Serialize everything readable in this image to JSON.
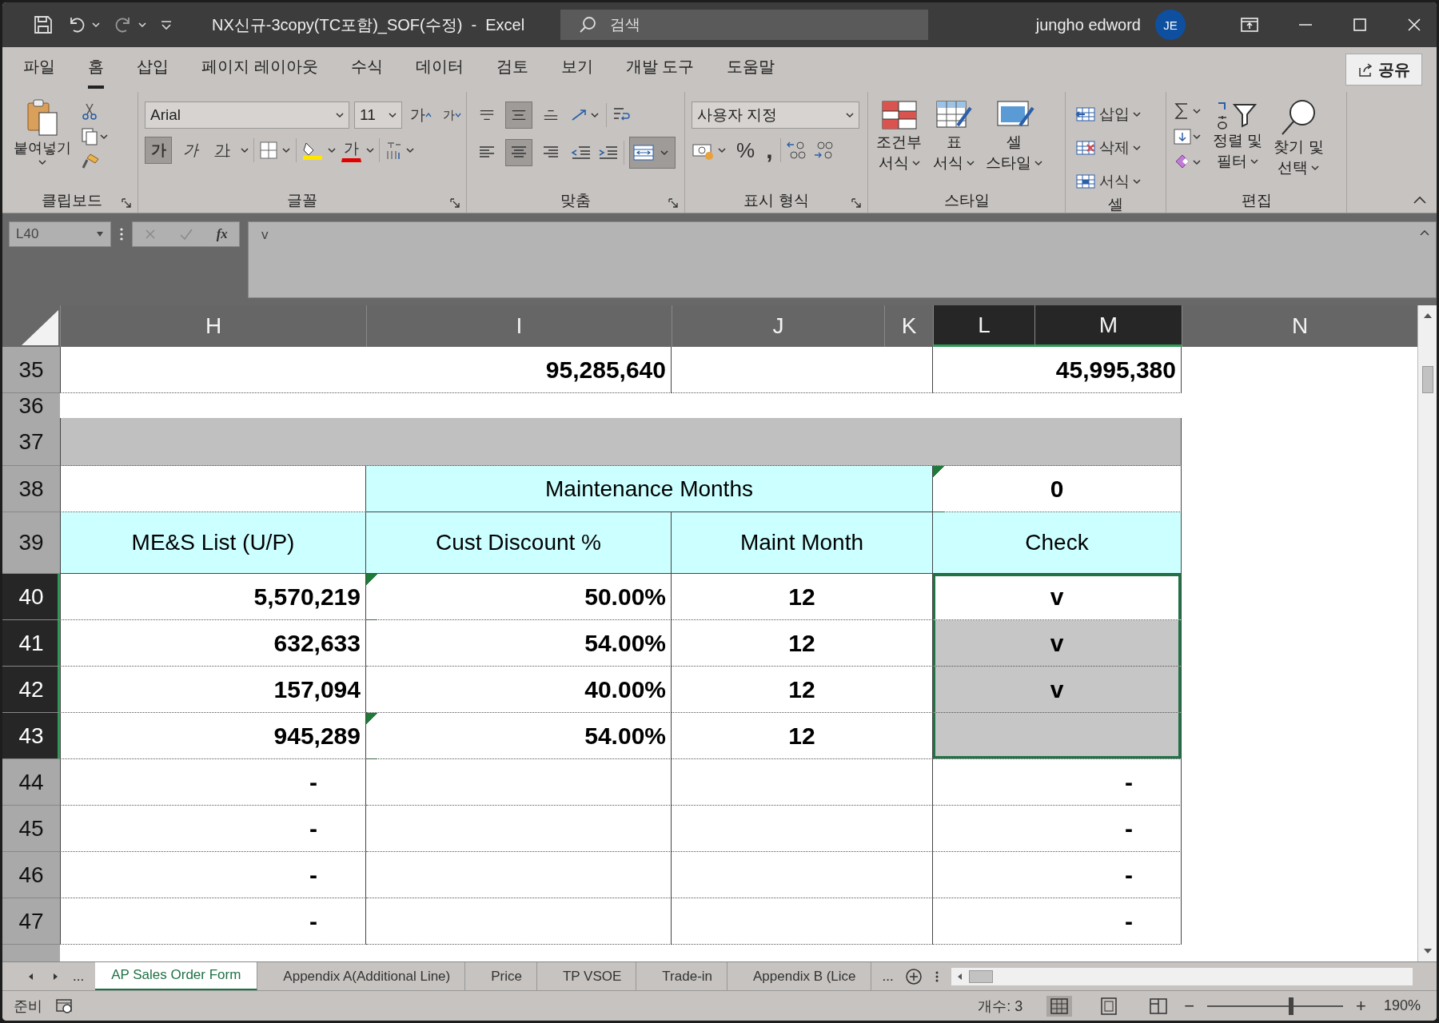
{
  "title_bar": {
    "title": "NX신규-3copy(TC포함)_SOF(수정)  -  Excel",
    "search": {
      "placeholder": "검색"
    },
    "user": "jungho edword",
    "avatar": "JE"
  },
  "menu_tabs": [
    {
      "label": "파일",
      "selected": false
    },
    {
      "label": "홈",
      "selected": true
    },
    {
      "label": "삽입",
      "selected": false
    },
    {
      "label": "페이지 레이아웃",
      "selected": false
    },
    {
      "label": "수식",
      "selected": false
    },
    {
      "label": "데이터",
      "selected": false
    },
    {
      "label": "검토",
      "selected": false
    },
    {
      "label": "보기",
      "selected": false
    },
    {
      "label": "개발 도구",
      "selected": false
    },
    {
      "label": "도움말",
      "selected": false
    }
  ],
  "share_button": "공유",
  "ribbon": {
    "clipboard": {
      "paste": "붙여넣기",
      "label": "클립보드"
    },
    "font": {
      "name": "Arial",
      "size": "11",
      "grow": "가",
      "shrink": "가",
      "bold": {
        "text": "가",
        "selected": true
      },
      "italic": {
        "text": "가",
        "selected": false
      },
      "underline": {
        "text": "가",
        "selected": false
      },
      "font_color": "가",
      "label": "글꼴"
    },
    "alignment": {
      "vertical": [
        {
          "selected": false
        },
        {
          "selected": true
        },
        {
          "selected": false
        }
      ],
      "horizontal": [
        {
          "selected": false
        },
        {
          "selected": true
        },
        {
          "selected": false
        }
      ],
      "merge": {
        "selected": true
      },
      "label": "맞춤"
    },
    "number": {
      "format": "사용자 지정",
      "percent": "%",
      "comma": ",",
      "label": "표시 형식"
    },
    "styles": {
      "items": [
        {
          "kind": "conditional",
          "line1": "조건부",
          "line2": "서식"
        },
        {
          "kind": "table",
          "line1": "표",
          "line2": "서식"
        },
        {
          "kind": "cell",
          "line1": "셀",
          "line2": "스타일"
        }
      ],
      "label": "스타일"
    },
    "cells": {
      "items": [
        {
          "kind": "insert",
          "label": "삽입"
        },
        {
          "kind": "delete",
          "label": "삭제"
        },
        {
          "kind": "format",
          "label": "서식"
        }
      ],
      "label": "셀"
    },
    "editing": {
      "sort": {
        "line1": "정렬 및",
        "line2": "필터"
      },
      "find": {
        "line1": "찾기 및",
        "line2": "선택"
      },
      "label": "편집"
    }
  },
  "formula_bar": {
    "name_box": "L40",
    "fx": "fx",
    "value": "v"
  },
  "columns": [
    {
      "label": "H",
      "selected": false
    },
    {
      "label": "I",
      "selected": false
    },
    {
      "label": "J",
      "selected": false
    },
    {
      "label": "K",
      "selected": false
    },
    {
      "label": "L",
      "selected": true
    },
    {
      "label": "M",
      "selected": true
    },
    {
      "label": "N",
      "selected": false
    }
  ],
  "rows": [
    {
      "number": "35",
      "kind": "normal",
      "selected": false,
      "cells": [
        {
          "kind": "hi",
          "header": false,
          "text": "95,285,640",
          "selected": false,
          "flag": false
        },
        {
          "kind": "jk",
          "header": false,
          "selected": false,
          "flag": false
        },
        {
          "kind": "lm-right",
          "header": false,
          "text": "45,995,380",
          "selected": false,
          "flag": false
        }
      ]
    },
    {
      "number": "36",
      "kind": "spacer",
      "selected": false,
      "cells": []
    },
    {
      "number": "37",
      "kind": "band",
      "selected": false,
      "cells": [
        {
          "kind": "hm",
          "header": false,
          "selected": false,
          "flag": false
        }
      ]
    },
    {
      "number": "38",
      "kind": "normal",
      "selected": false,
      "cells": [
        {
          "kind": "h",
          "header": false,
          "selected": false,
          "flag": false
        },
        {
          "kind": "ijk",
          "header": true,
          "text": "Maintenance Months",
          "selected": false,
          "flag": false
        },
        {
          "kind": "lm",
          "header": false,
          "text": "0",
          "selected": false,
          "flag": true
        }
      ]
    },
    {
      "number": "39",
      "kind": "tall",
      "selected": false,
      "cells": [
        {
          "kind": "h",
          "header": true,
          "text": "ME&S List (U/P)",
          "selected": false,
          "flag": false
        },
        {
          "kind": "i",
          "header": true,
          "text": "Cust Discount %",
          "selected": false,
          "flag": false
        },
        {
          "kind": "jk",
          "header": true,
          "text": "Maint Month",
          "selected": false,
          "flag": false
        },
        {
          "kind": "lm",
          "header": true,
          "text": "Check",
          "selected": false,
          "flag": false
        }
      ]
    },
    {
      "number": "40",
      "kind": "normal",
      "selected": true,
      "cells": [
        {
          "kind": "h",
          "header": false,
          "text": "5,570,219",
          "selected": false,
          "flag": false
        },
        {
          "kind": "i",
          "header": false,
          "text": "50.00%",
          "selected": false,
          "flag": true
        },
        {
          "kind": "jk",
          "header": false,
          "text": "12",
          "selected": false,
          "flag": false
        },
        {
          "kind": "lm",
          "header": false,
          "text": "v",
          "selected": true,
          "active": true,
          "flag": false
        }
      ]
    },
    {
      "number": "41",
      "kind": "normal",
      "selected": true,
      "cells": [
        {
          "kind": "h",
          "header": false,
          "text": "632,633",
          "selected": false,
          "flag": false
        },
        {
          "kind": "i",
          "header": false,
          "text": "54.00%",
          "selected": false,
          "flag": false
        },
        {
          "kind": "jk",
          "header": false,
          "text": "12",
          "selected": false,
          "flag": false
        },
        {
          "kind": "lm",
          "header": false,
          "text": "v",
          "selected": true,
          "active": false,
          "flag": false
        }
      ]
    },
    {
      "number": "42",
      "kind": "normal",
      "selected": true,
      "cells": [
        {
          "kind": "h",
          "header": false,
          "text": "157,094",
          "selected": false,
          "flag": false
        },
        {
          "kind": "i",
          "header": false,
          "text": "40.00%",
          "selected": false,
          "flag": false
        },
        {
          "kind": "jk",
          "header": false,
          "text": "12",
          "selected": false,
          "flag": false
        },
        {
          "kind": "lm",
          "header": false,
          "text": "v",
          "selected": true,
          "active": false,
          "flag": false
        }
      ]
    },
    {
      "number": "43",
      "kind": "normal",
      "selected": true,
      "cells": [
        {
          "kind": "h",
          "header": false,
          "text": "945,289",
          "selected": false,
          "flag": false
        },
        {
          "kind": "i",
          "header": false,
          "text": "54.00%",
          "selected": false,
          "flag": true
        },
        {
          "kind": "jk",
          "header": false,
          "text": "12",
          "selected": false,
          "flag": false
        },
        {
          "kind": "lm",
          "header": false,
          "selected": true,
          "active": false,
          "flag": false
        }
      ]
    },
    {
      "number": "44",
      "kind": "normal",
      "selected": false,
      "cells": [
        {
          "kind": "h-dash",
          "header": false,
          "text": "-",
          "selected": false,
          "flag": false
        },
        {
          "kind": "i",
          "header": false,
          "selected": false,
          "flag": false
        },
        {
          "kind": "jk",
          "header": false,
          "selected": false,
          "flag": false
        },
        {
          "kind": "lm-dash",
          "header": false,
          "text": "-",
          "selected": false,
          "flag": false
        }
      ]
    },
    {
      "number": "45",
      "kind": "normal",
      "selected": false,
      "cells": [
        {
          "kind": "h-dash",
          "header": false,
          "text": "-",
          "selected": false,
          "flag": false
        },
        {
          "kind": "i",
          "header": false,
          "selected": false,
          "flag": false
        },
        {
          "kind": "jk",
          "header": false,
          "selected": false,
          "flag": false
        },
        {
          "kind": "lm-dash",
          "header": false,
          "text": "-",
          "selected": false,
          "flag": false
        }
      ]
    },
    {
      "number": "46",
      "kind": "normal",
      "selected": false,
      "cells": [
        {
          "kind": "h-dash",
          "header": false,
          "text": "-",
          "selected": false,
          "flag": false
        },
        {
          "kind": "i",
          "header": false,
          "selected": false,
          "flag": false
        },
        {
          "kind": "jk",
          "header": false,
          "selected": false,
          "flag": false
        },
        {
          "kind": "lm-dash",
          "header": false,
          "text": "-",
          "selected": false,
          "flag": false
        }
      ]
    },
    {
      "number": "47",
      "kind": "normal",
      "selected": false,
      "cells": [
        {
          "kind": "h-dash",
          "header": false,
          "text": "-",
          "selected": false,
          "flag": false
        },
        {
          "kind": "i",
          "header": false,
          "selected": false,
          "flag": false
        },
        {
          "kind": "jk",
          "header": false,
          "selected": false,
          "flag": false
        },
        {
          "kind": "lm-dash",
          "header": false,
          "text": "-",
          "selected": false,
          "flag": false
        }
      ]
    }
  ],
  "sheet_tabs": {
    "more": "...",
    "tabs": [
      {
        "label": "AP Sales Order Form",
        "selected": true
      },
      {
        "label": "Appendix A(Additional Line)",
        "selected": false
      },
      {
        "label": "Price",
        "selected": false
      },
      {
        "label": "TP VSOE",
        "selected": false
      },
      {
        "label": "Trade-in",
        "selected": false
      },
      {
        "label": "Appendix B (Lice",
        "selected": false
      }
    ],
    "overflow": "..."
  },
  "status_bar": {
    "ready": "준비",
    "count": "개수: 3",
    "zoom_minus": "−",
    "zoom_plus": "+",
    "zoom": "190%",
    "zoom_slider": {
      "level": 0.62
    }
  }
}
